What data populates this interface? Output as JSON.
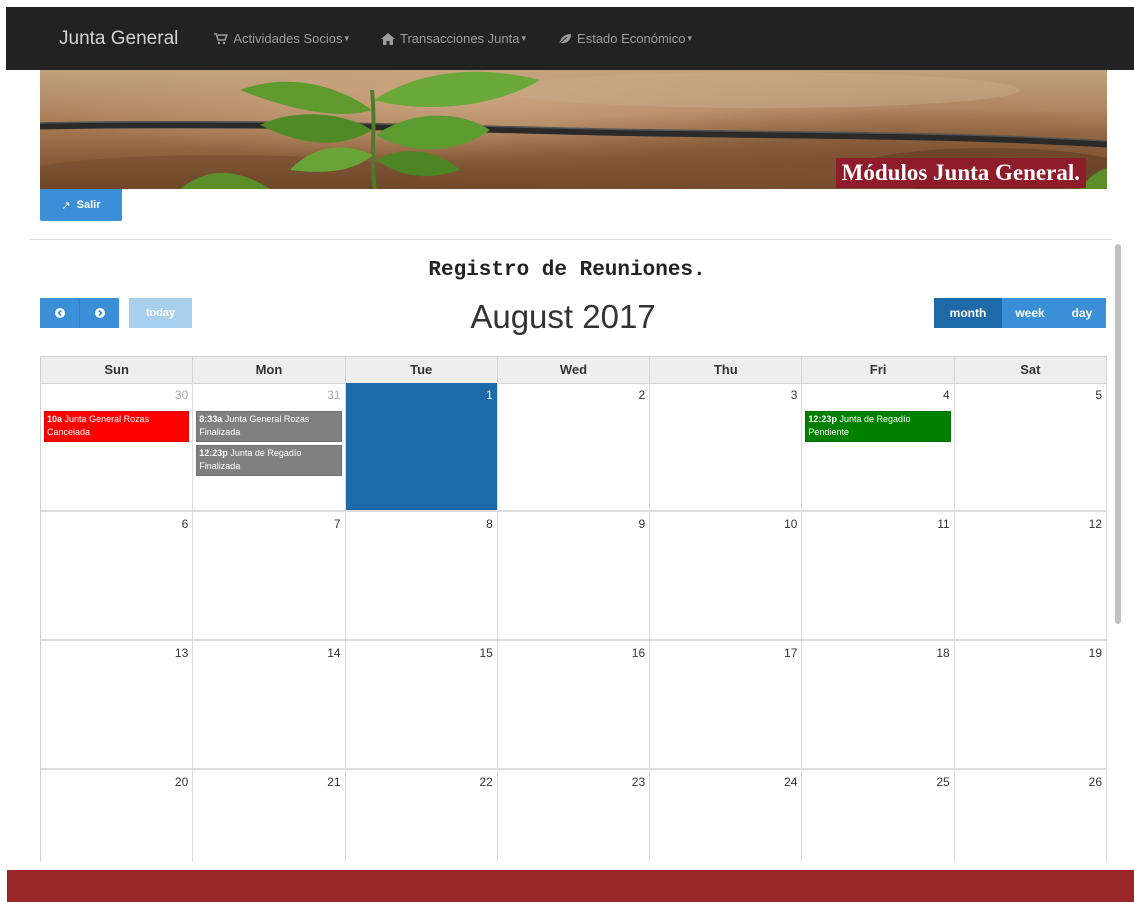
{
  "navbar": {
    "brand": "Junta General",
    "items": [
      {
        "label": "Actividades Socios",
        "icon": "cart-icon"
      },
      {
        "label": "Transacciones Junta",
        "icon": "home-icon"
      },
      {
        "label": "Estado Económico",
        "icon": "leaf-icon"
      }
    ]
  },
  "banner": {
    "title": "Módulos Junta General."
  },
  "salir_label": "Salir",
  "calendar": {
    "heading": "Registro de Reuniones.",
    "month_title": "August 2017",
    "today_label": "today",
    "views": [
      "month",
      "week",
      "day"
    ],
    "active_view": "month",
    "day_headers": [
      "Sun",
      "Mon",
      "Tue",
      "Wed",
      "Thu",
      "Fri",
      "Sat"
    ],
    "weeks": [
      [
        {
          "num": "30",
          "other": true,
          "events": [
            {
              "time": "10a",
              "title": "Junta General Rozas",
              "status": "Cancelada",
              "color": "#ff0000"
            }
          ]
        },
        {
          "num": "31",
          "other": true,
          "events": [
            {
              "time": "8:33a",
              "title": "Junta General Rozas",
              "status": "Finalizada",
              "color": "#808080"
            },
            {
              "time": "12:23p",
              "title": "Junta de Regadío",
              "status": "Finalizada",
              "color": "#808080"
            }
          ]
        },
        {
          "num": "1",
          "today": true,
          "events": []
        },
        {
          "num": "2",
          "events": []
        },
        {
          "num": "3",
          "events": []
        },
        {
          "num": "4",
          "events": [
            {
              "time": "12:23p",
              "title": "Junta de Regadío",
              "status": "Pendiente",
              "color": "#008000"
            }
          ]
        },
        {
          "num": "5",
          "events": []
        }
      ],
      [
        {
          "num": "6",
          "events": []
        },
        {
          "num": "7",
          "events": []
        },
        {
          "num": "8",
          "events": []
        },
        {
          "num": "9",
          "events": []
        },
        {
          "num": "10",
          "events": []
        },
        {
          "num": "11",
          "events": []
        },
        {
          "num": "12",
          "events": []
        }
      ],
      [
        {
          "num": "13",
          "events": []
        },
        {
          "num": "14",
          "events": []
        },
        {
          "num": "15",
          "events": []
        },
        {
          "num": "16",
          "events": []
        },
        {
          "num": "17",
          "events": []
        },
        {
          "num": "18",
          "events": []
        },
        {
          "num": "19",
          "events": []
        }
      ],
      [
        {
          "num": "20",
          "events": []
        },
        {
          "num": "21",
          "events": []
        },
        {
          "num": "22",
          "events": []
        },
        {
          "num": "23",
          "events": []
        },
        {
          "num": "24",
          "events": []
        },
        {
          "num": "25",
          "events": []
        },
        {
          "num": "26",
          "events": []
        }
      ]
    ]
  },
  "colors": {
    "navbar": "#222222",
    "primary_button": "#3a8fd7",
    "today_cell": "#1e6aa9",
    "banner_title_bg": "#8e1c2a",
    "footer": "#9a2526"
  }
}
